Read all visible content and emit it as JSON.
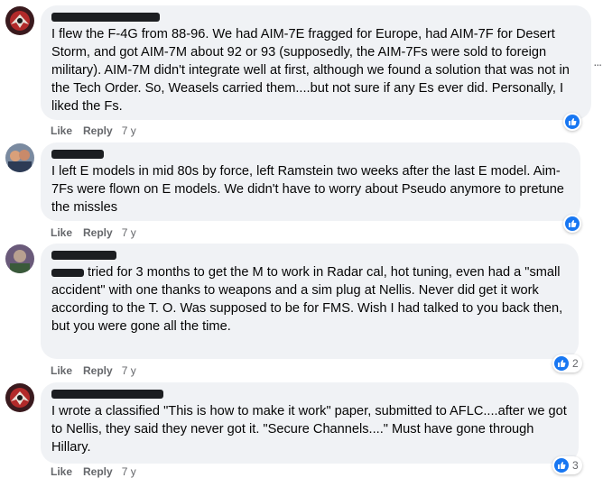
{
  "comments": [
    {
      "text": "I flew the F-4G from 88-96. We had AIM-7E fragged for Europe, had AIM-7F for Desert Storm, and got AIM-7M about 92 or 93 (supposedly, the AIM-7Fs were sold to foreign military). AIM-7M didn't integrate well at first, although we found a solution that was not in the Tech Order. So, Weasels carried them....but not sure if any Es ever did. Personally, I liked the Fs.",
      "like": "Like",
      "reply": "Reply",
      "time": "7 y",
      "reaction_count": ""
    },
    {
      "text": "I left E models in mid 80s by force, left Ramstein two weeks after the last E model. Aim-7Fs were flown on E models. We didn't have to worry about Pseudo anymore to pretune the missles",
      "like": "Like",
      "reply": "Reply",
      "time": "7 y",
      "reaction_count": ""
    },
    {
      "text": "tried for 3 months to get the M to work in Radar cal, hot tuning, even had a \"small accident\" with one thanks to weapons and a sim plug at Nellis. Never did get it work according to the T. O. Was supposed to be for FMS. Wish I had talked to you back then, but you were gone all the time.",
      "like": "Like",
      "reply": "Reply",
      "time": "7 y",
      "reaction_count": "2"
    },
    {
      "text": "I wrote a classified \"This is how to make it work\" paper, submitted to AFLC....after we got to Nellis, they said they never got it. \"Secure Channels....\" Must have gone through Hillary.",
      "like": "Like",
      "reply": "Reply",
      "time": "7 y",
      "reaction_count": "3"
    }
  ],
  "more_options": "...",
  "colors": {
    "bubble": "#f0f2f5",
    "like_blue": "#1877f2",
    "meta_gray": "#65676b"
  },
  "icons": {
    "reaction": "thumbs-up-icon",
    "menu": "more-options-icon"
  }
}
